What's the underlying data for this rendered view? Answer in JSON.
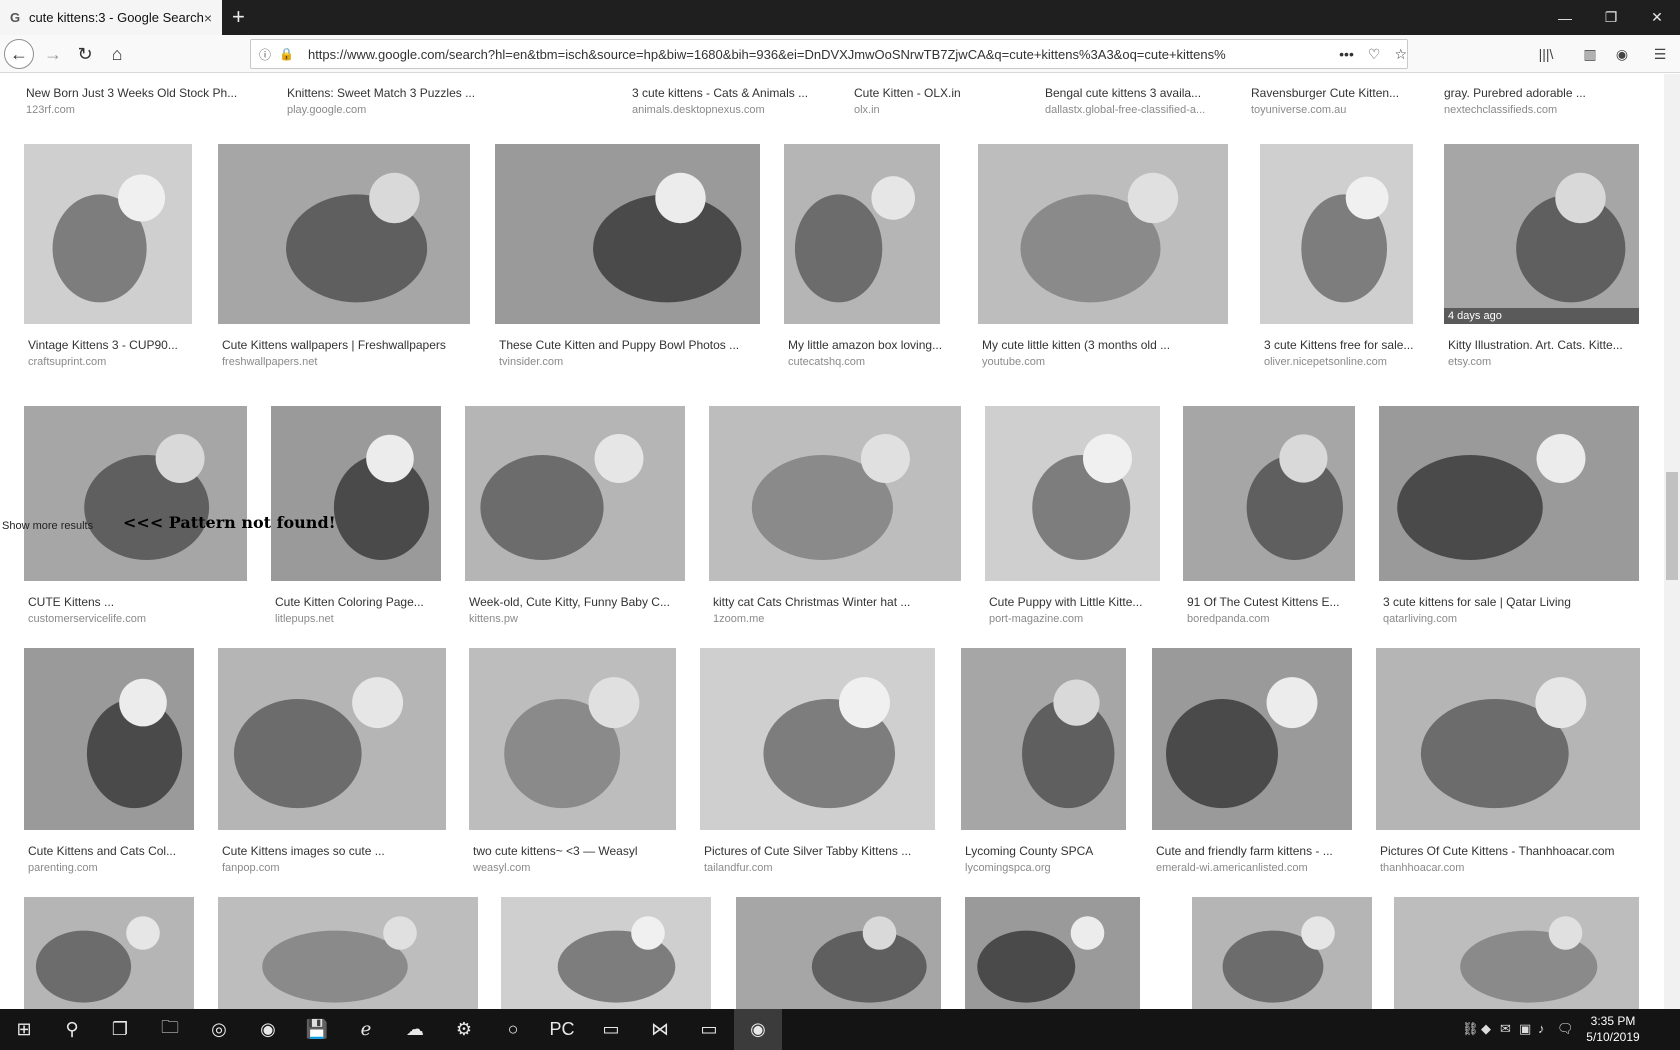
{
  "tab": {
    "title": "cute kittens:3 - Google Search",
    "favicon": "G",
    "close_icon": "×"
  },
  "window": {
    "new_tab": "+",
    "minimize": "—",
    "restore": "❐",
    "close": "✕"
  },
  "nav": {
    "back": "←",
    "forward": "→",
    "reload": "↻",
    "home": "⌂",
    "url": "https://www.google.com/search?hl=en&tbm=isch&source=hp&biw=1680&bih=936&ei=DnDVXJmwOoSNrwTB7ZjwCA&q=cute+kittens%3A3&oq=cute+kittens%",
    "info_icon": "ⓘ",
    "lock_icon": "🔒",
    "more": "•••",
    "pocket": "♡",
    "star": "☆"
  },
  "toolbar_right": {
    "library": "|||\\",
    "sidebar": "▥",
    "account": "◉",
    "menu": "☰"
  },
  "page": {
    "show_more": "Show more results",
    "pattern_not_found": "<<< Pattern not found!",
    "row0": [
      {
        "caption": "New Born Just 3 Weeks Old Stock Ph...",
        "source": "123rf.com"
      },
      {
        "caption": "Knittens: Sweet Match 3 Puzzles ...",
        "source": "play.google.com"
      },
      {
        "caption": "3 cute kittens - Cats & Animals ...",
        "source": "animals.desktopnexus.com"
      },
      {
        "caption": "Cute Kitten - OLX.in",
        "source": "olx.in"
      },
      {
        "caption": "Bengal cute kittens 3 availa...",
        "source": "dallastx.global-free-classified-a..."
      },
      {
        "caption": "Ravensburger Cute Kitten...",
        "source": "toyuniverse.com.au"
      },
      {
        "caption": "gray. Purebred adorable ...",
        "source": "nextechclassifieds.com"
      }
    ],
    "row1": [
      {
        "caption": "Vintage Kittens 3 - CUP90...",
        "source": "craftsuprint.com"
      },
      {
        "caption": "Cute Kittens wallpapers | Freshwallpapers",
        "source": "freshwallpapers.net"
      },
      {
        "caption": "These Cute Kitten and Puppy Bowl Photos ...",
        "source": "tvinsider.com"
      },
      {
        "caption": "My little amazon box loving...",
        "source": "cutecatshq.com"
      },
      {
        "caption": "My cute little kitten (3 months old ...",
        "source": "youtube.com"
      },
      {
        "caption": "3 cute Kittens free for sale...",
        "source": "oliver.nicepetsonline.com"
      },
      {
        "caption": "Kitty Illustration. Art. Cats. Kitte...",
        "source": "etsy.com",
        "badge": "4 days ago"
      }
    ],
    "row2": [
      {
        "caption": "CUTE Kittens ...",
        "source": "customerservicelife.com"
      },
      {
        "caption": "Cute Kitten Coloring Page...",
        "source": "litlepups.net"
      },
      {
        "caption": "Week-old, Cute Kitty, Funny Baby C...",
        "source": "kittens.pw"
      },
      {
        "caption": "kitty cat Cats Christmas Winter hat ...",
        "source": "1zoom.me"
      },
      {
        "caption": "Cute Puppy with Little Kitte...",
        "source": "port-magazine.com"
      },
      {
        "caption": "91 Of The Cutest Kittens E...",
        "source": "boredpanda.com"
      },
      {
        "caption": "3 cute kittens for sale | Qatar Living",
        "source": "qatarliving.com"
      }
    ],
    "row3": [
      {
        "caption": "Cute Kittens and Cats Col...",
        "source": "parenting.com"
      },
      {
        "caption": "Cute Kittens images so cute ...",
        "source": "fanpop.com"
      },
      {
        "caption": "two cute kittens~ <3 — Weasyl",
        "source": "weasyl.com"
      },
      {
        "caption": "Pictures of Cute Silver Tabby Kittens ...",
        "source": "tailandfur.com"
      },
      {
        "caption": "Lycoming County SPCA",
        "source": "lycomingspca.org"
      },
      {
        "caption": "Cute and friendly farm kittens - ...",
        "source": "emerald-wi.americanlisted.com"
      },
      {
        "caption": "Pictures Of Cute Kittens - Thanhhoacar.com",
        "source": "thanhhoacar.com"
      }
    ],
    "row4": [
      {},
      {},
      {},
      {},
      {},
      {},
      {}
    ]
  },
  "taskbar": {
    "start": "⊞",
    "search": "⚲",
    "taskview": "❐",
    "apps": [
      "🗀",
      "◎",
      "◉",
      "💾",
      "ℯ",
      "☁",
      "⚙",
      "○",
      "PC",
      "▭",
      "⋈",
      "▭",
      "◉"
    ],
    "tray": [
      "⛓",
      "◆",
      "✉",
      "▣",
      "♪",
      "🗨"
    ],
    "time": "3:35 PM",
    "date": "5/10/2019"
  }
}
